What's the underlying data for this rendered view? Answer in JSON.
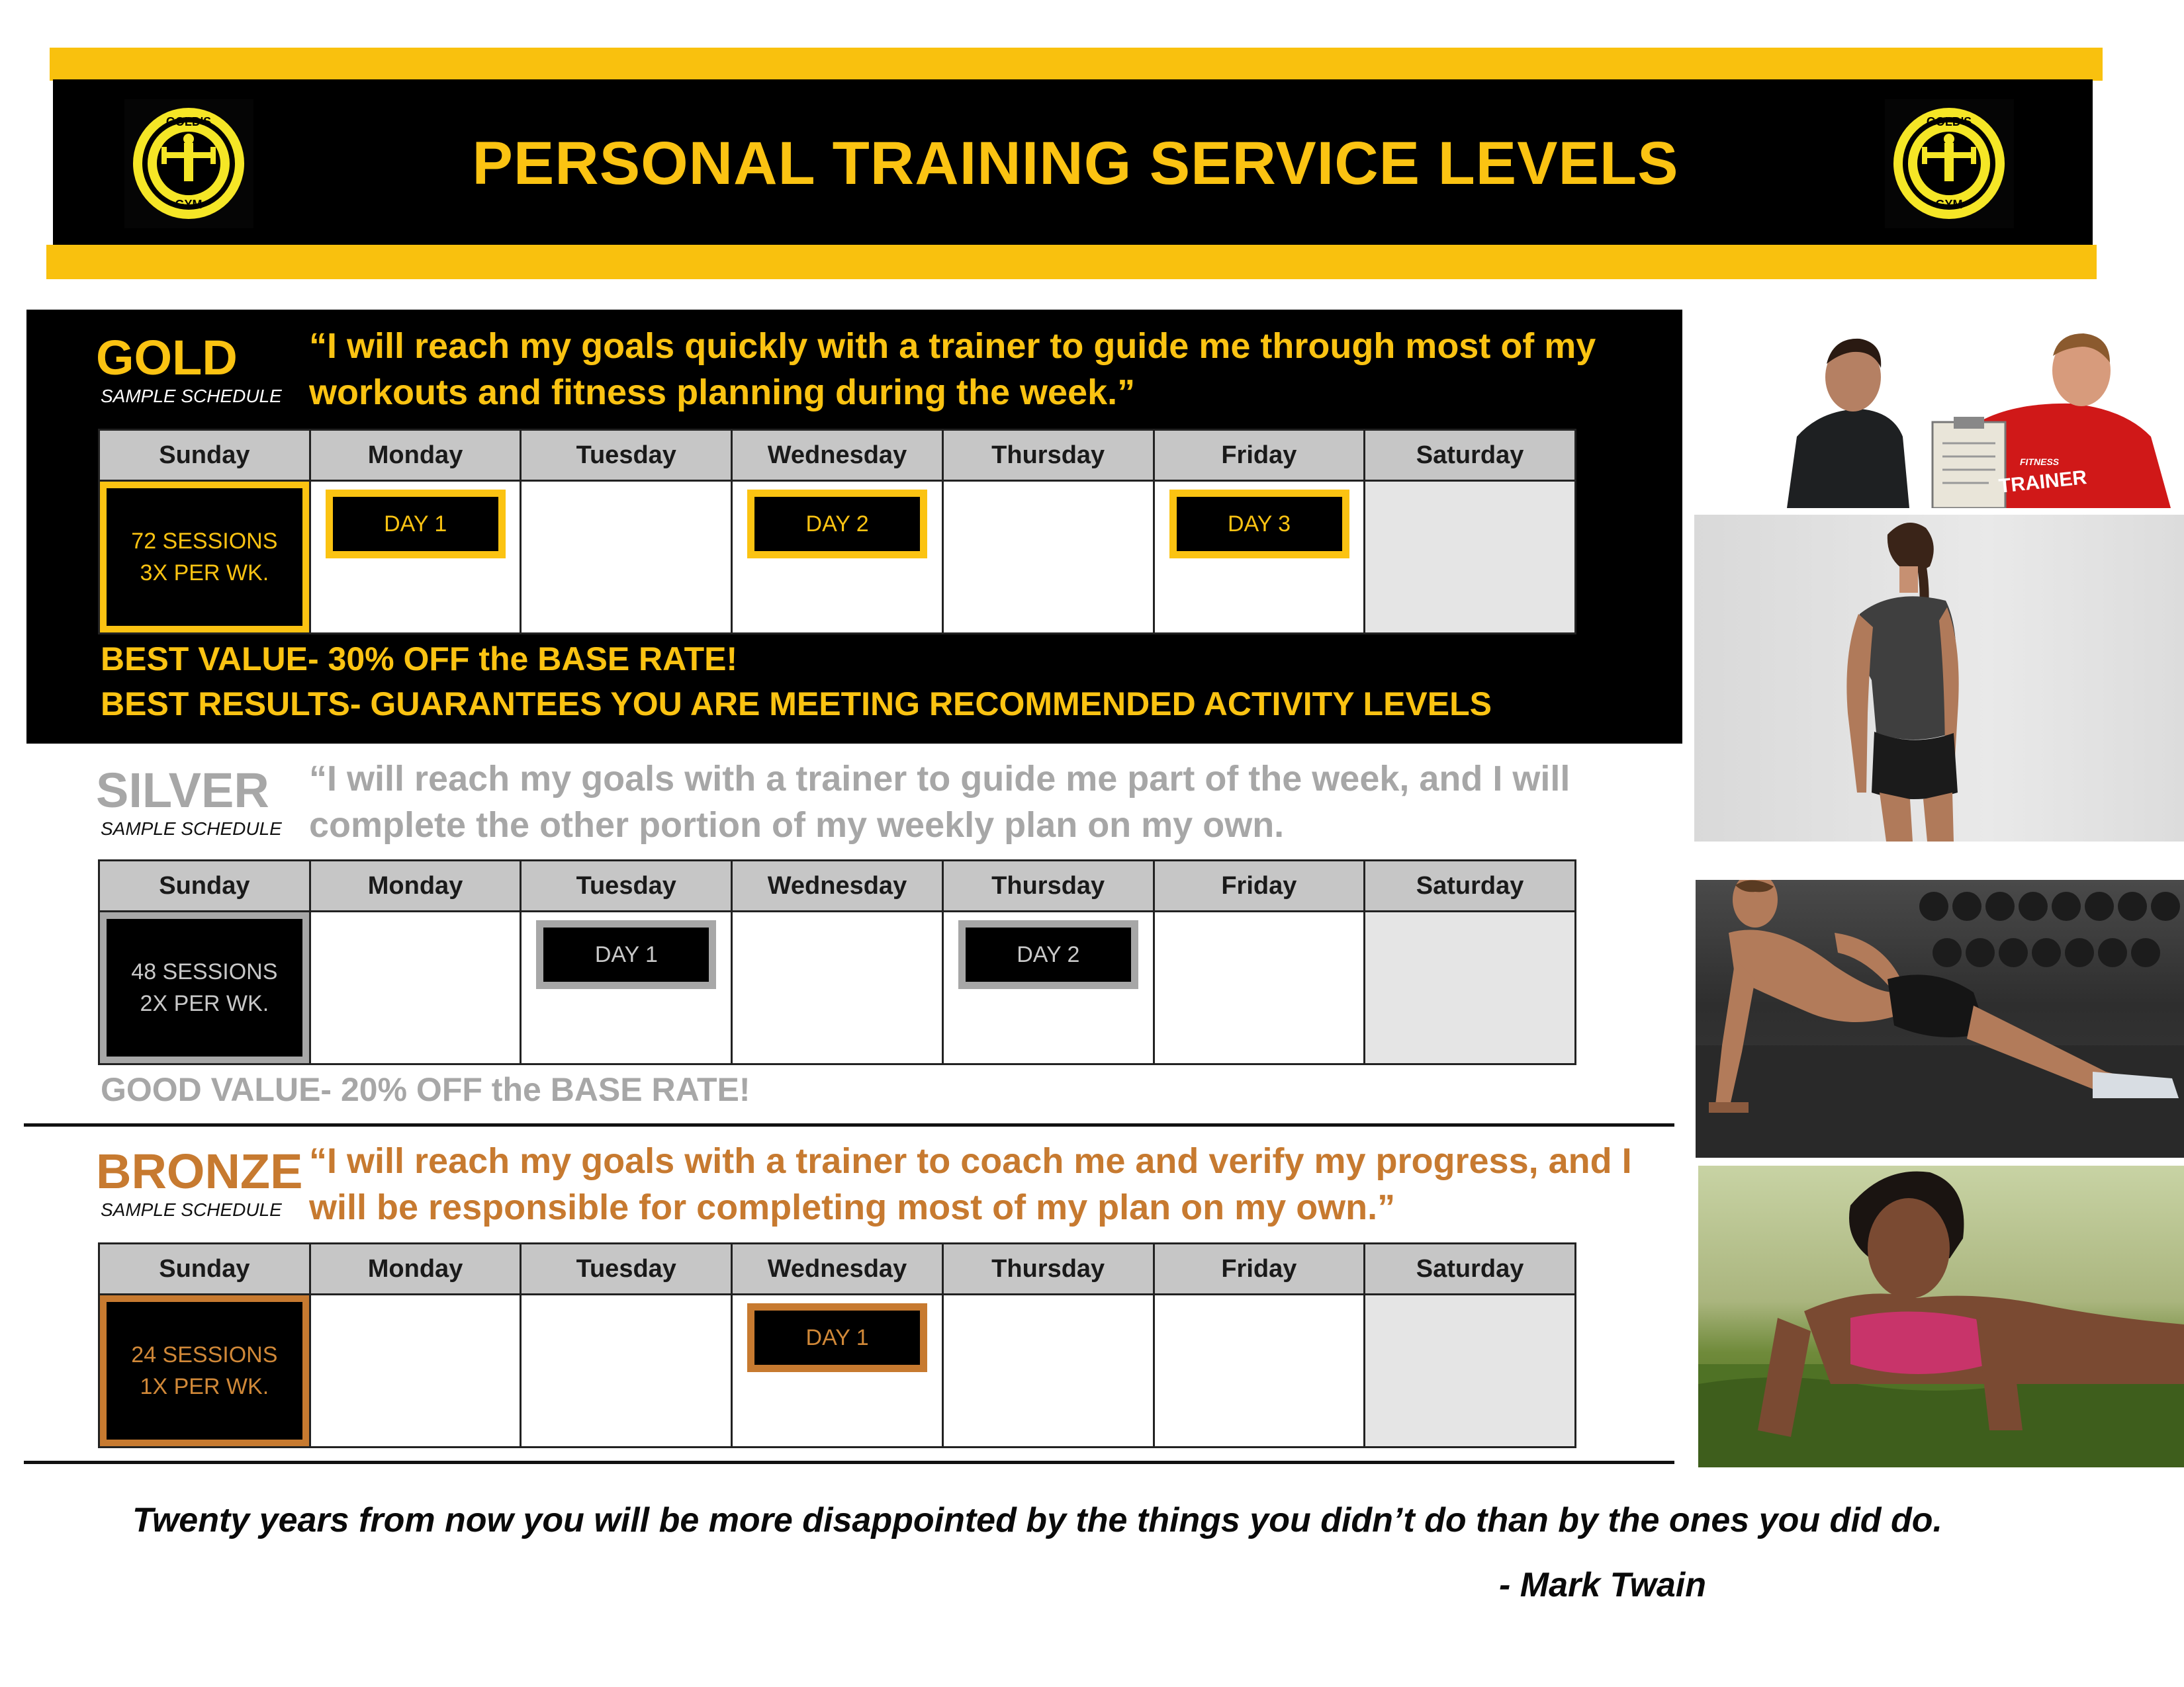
{
  "header": {
    "title": "PERSONAL TRAINING SERVICE LEVELS",
    "logo_text": "GOLD'S GYM"
  },
  "days": [
    "Sunday",
    "Monday",
    "Tuesday",
    "Wednesday",
    "Thursday",
    "Friday",
    "Saturday"
  ],
  "colors": {
    "gold": "#fbc312",
    "silver": "#a7a7a7",
    "bronze": "#c77a30",
    "header_bar": "#f9c10e"
  },
  "gold": {
    "name": "GOLD",
    "sample": "SAMPLE SCHEDULE",
    "quote": "“I will reach my goals quickly with a trainer to guide me through most of my workouts and fitness planning during the week.”",
    "sessions_line1": "72 SESSIONS",
    "sessions_line2": "3X PER WK.",
    "day_a": "DAY 1",
    "day_b": "DAY 2",
    "day_c": "DAY 3",
    "note1": "BEST VALUE- 30% OFF the BASE RATE!",
    "note2": "BEST RESULTS- GUARANTEES YOU ARE MEETING RECOMMENDED ACTIVITY LEVELS"
  },
  "silver": {
    "name": "SILVER",
    "sample": "SAMPLE SCHEDULE",
    "quote": "“I will reach my goals with a trainer to guide me part of the week, and I will complete the other portion of my weekly plan on my own.",
    "sessions_line1": "48 SESSIONS",
    "sessions_line2": "2X PER WK.",
    "day_a": "DAY 1",
    "day_b": "DAY 2",
    "note1": "GOOD VALUE- 20% OFF the BASE RATE!"
  },
  "bronze": {
    "name": "BRONZE",
    "sample": "SAMPLE SCHEDULE",
    "quote": "“I will reach my goals with a trainer to coach me and verify my progress, and I will be responsible for completing most of my plan on my own.”",
    "sessions_line1": "24 SESSIONS",
    "sessions_line2": "1X PER WK.",
    "day_a": "DAY 1"
  },
  "photos": {
    "trainer_badge_line1": "FITNESS",
    "trainer_badge_line2": "TRAINER"
  },
  "footer": {
    "quote": "Twenty years from now you will be more disappointed  by the things you didn’t do than by the ones you did do.",
    "author": "- Mark Twain"
  }
}
